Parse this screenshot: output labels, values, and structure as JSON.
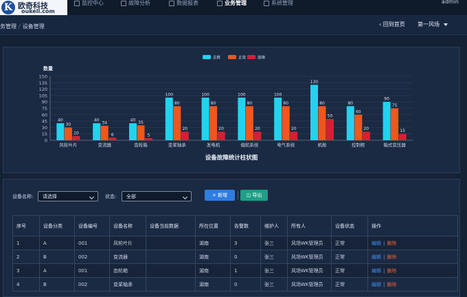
{
  "brand": {
    "logo_mark": "K",
    "name_cn": "欧奇科技",
    "name_en": "oukell.com"
  },
  "nav": {
    "items": [
      {
        "label": "监控中心",
        "active": false
      },
      {
        "label": "故障分析",
        "active": false
      },
      {
        "label": "数据报表",
        "active": false
      },
      {
        "label": "业务管理",
        "active": true
      },
      {
        "label": "系统管理",
        "active": false
      }
    ],
    "user": "admin"
  },
  "breadcrumb": {
    "parent": "务管理",
    "current": "设备管理"
  },
  "header": {
    "back_label": "回到首页",
    "farm": "第一风场"
  },
  "chart_data": {
    "type": "bar",
    "title": "设备故障统计柱状图",
    "ylabel": "数量",
    "xlabel": "",
    "ylim": [
      0,
      150
    ],
    "yticks": [
      0,
      15,
      30,
      45,
      60,
      75,
      90,
      105,
      120,
      135,
      150
    ],
    "legend_position": "top-center",
    "categories": [
      "风轮叶片",
      "变流器",
      "齿轮箱",
      "变桨轴承",
      "发电机",
      "偏航系统",
      "电气系统",
      "机舱",
      "控制柜",
      "箱式变压器"
    ],
    "series": [
      {
        "name": "总数",
        "color": "#22d3ee",
        "values": [
          40,
          40,
          40,
          100,
          100,
          100,
          100,
          130,
          80,
          90
        ]
      },
      {
        "name": "正常",
        "color": "#f0561d",
        "values": [
          30,
          34,
          35,
          80,
          80,
          80,
          80,
          80,
          60,
          75
        ]
      },
      {
        "name": "故障",
        "color": "#d42035",
        "values": [
          10,
          6,
          5,
          20,
          20,
          20,
          20,
          50,
          20,
          15
        ]
      }
    ]
  },
  "filters": {
    "device_name_label": "设备名称:",
    "device_name_value": "请选择",
    "status_label": "状态:",
    "status_value": "全部",
    "add_label": "+ 新增",
    "export_label": "导出",
    "export_icon": "export-icon"
  },
  "table": {
    "headers": [
      "序号",
      "设备分类",
      "设备编号",
      "设备名称",
      "设备当前数据",
      "所在位置",
      "告警数",
      "维护人",
      "所有人",
      "设备状态",
      "操作"
    ],
    "rows": [
      {
        "no": "1",
        "category": "A",
        "code": "001",
        "name": "风轮叶片",
        "data": "",
        "location": "湖南",
        "alarms": "3",
        "maintainer": "张三",
        "owner": "风场WK管理员",
        "status": "正常",
        "edit": "编辑",
        "sep": "|",
        "del": "删除"
      },
      {
        "no": "2",
        "category": "B",
        "code": "002",
        "name": "变流器",
        "data": "",
        "location": "湖南",
        "alarms": "0",
        "maintainer": "张三",
        "owner": "风场WK管理员",
        "status": "正常",
        "edit": "编辑",
        "sep": "|",
        "del": "删除"
      },
      {
        "no": "3",
        "category": "A",
        "code": "001",
        "name": "齿轮箱",
        "data": "",
        "location": "湖南",
        "alarms": "1",
        "maintainer": "张三",
        "owner": "风场WK管理员",
        "status": "正常",
        "edit": "编辑",
        "sep": "|",
        "del": "删除"
      },
      {
        "no": "4",
        "category": "B",
        "code": "002",
        "name": "变桨轴承",
        "data": "",
        "location": "湖南",
        "alarms": "0",
        "maintainer": "张三",
        "owner": "风场WK管理员",
        "status": "正常",
        "edit": "编辑",
        "sep": "|",
        "del": "删除"
      }
    ]
  }
}
